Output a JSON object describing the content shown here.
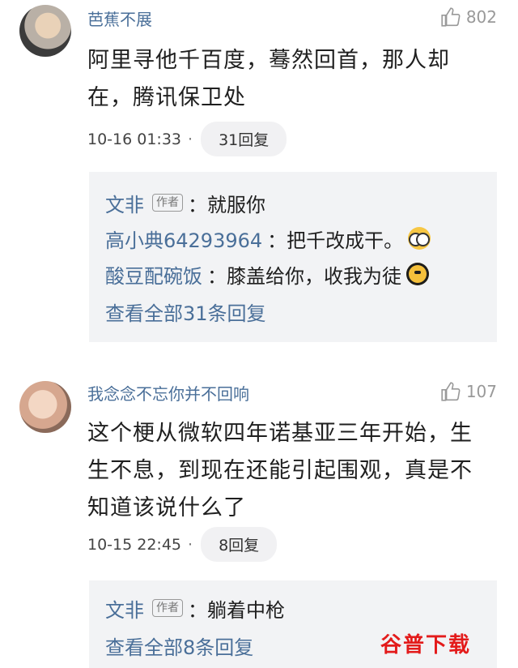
{
  "comments": [
    {
      "username": "芭蕉不展",
      "likes": "802",
      "text_lines": [
        "阿里寻他千百度，蓦然回首，那人却",
        "在，腾讯保卫处"
      ],
      "time": "10-16 01:33",
      "reply_count": "31回复",
      "replies": [
        {
          "name": "文非",
          "author_tag": "作者",
          "text": "：就服你"
        },
        {
          "name": "高小典64293964",
          "author_tag": "",
          "text": "：把千改成干。"
        },
        {
          "name": "酸豆配碗饭",
          "author_tag": "",
          "text": "：膝盖给你，收我为徒"
        }
      ],
      "view_all": "查看全部31条回复"
    },
    {
      "username": "我念念不忘你并不回响",
      "likes": "107",
      "text_lines": [
        "这个梗从微软四年诺基亚三年开始，生",
        "生不息，到现在还能引起围观，真是不",
        "知道该说什么了"
      ],
      "time": "10-15 22:45",
      "reply_count": "8回复",
      "replies": [
        {
          "name": "文非",
          "author_tag": "作者",
          "text": "：躺着中枪"
        }
      ],
      "view_all": "查看全部8条回复"
    }
  ],
  "watermark": "谷普下载",
  "colors": {
    "link": "#4a6f99",
    "watermark": "#e31b1b"
  }
}
